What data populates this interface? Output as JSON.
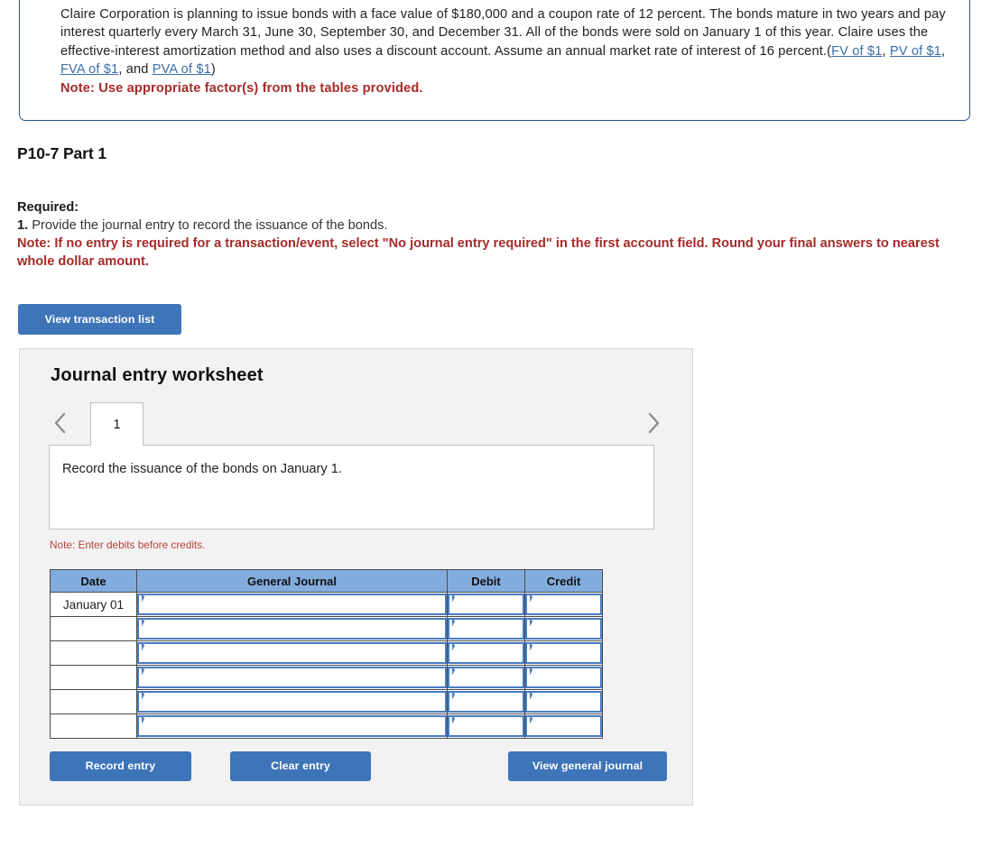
{
  "question": {
    "paragraph_part1": "Claire Corporation is planning to issue bonds with a face value of $180,000 and a coupon rate of 12 percent. The bonds mature in two years and pay interest quarterly every March 31, June 30, September 30, and December 31. All of the bonds were sold on January 1 of this year. Claire uses the effective-interest amortization method and also uses a discount account. Assume an annual market rate of interest of 16 percent.(",
    "link_fv": "FV of $1",
    "sep1": ", ",
    "link_pv": "PV of $1",
    "sep2": ", ",
    "link_fva": "FVA of $1",
    "sep3": ", and ",
    "link_pva": "PVA of $1",
    "paragraph_close": ")",
    "note": "Note: Use appropriate factor(s) from the tables provided."
  },
  "part_heading": "P10-7 Part 1",
  "required": {
    "label": "Required:",
    "item_number": "1.",
    "item_text": " Provide the journal entry to record the issuance of the bonds.",
    "note": "Note: If no entry is required for a transaction/event, select \"No journal entry required\" in the first account field. Round your final answers to nearest whole dollar amount."
  },
  "toolbar": {
    "view_transaction_list": "View transaction list"
  },
  "worksheet": {
    "title": "Journal entry worksheet",
    "prev_icon": "chevron-left-icon",
    "next_icon": "chevron-right-icon",
    "tabs": [
      {
        "label": "1",
        "active": true
      }
    ],
    "transaction_description": "Record the issuance of the bonds on January 1.",
    "enter_note": "Note: Enter debits before credits.",
    "table": {
      "headers": [
        "Date",
        "General Journal",
        "Debit",
        "Credit"
      ],
      "rows": [
        {
          "date": "January 01",
          "general_journal": "",
          "debit": "",
          "credit": ""
        },
        {
          "date": "",
          "general_journal": "",
          "debit": "",
          "credit": ""
        },
        {
          "date": "",
          "general_journal": "",
          "debit": "",
          "credit": ""
        },
        {
          "date": "",
          "general_journal": "",
          "debit": "",
          "credit": ""
        },
        {
          "date": "",
          "general_journal": "",
          "debit": "",
          "credit": ""
        },
        {
          "date": "",
          "general_journal": "",
          "debit": "",
          "credit": ""
        }
      ]
    },
    "buttons": {
      "record_entry": "Record entry",
      "clear_entry": "Clear entry",
      "view_general_journal": "View general journal"
    }
  },
  "colors": {
    "accent_blue": "#3e74b8",
    "table_header_blue": "#82acdd",
    "field_border_blue": "#4b7cbe",
    "note_red": "#a62b28",
    "link_blue": "#3a6ea8",
    "panel_gray": "#f2f2f2"
  }
}
